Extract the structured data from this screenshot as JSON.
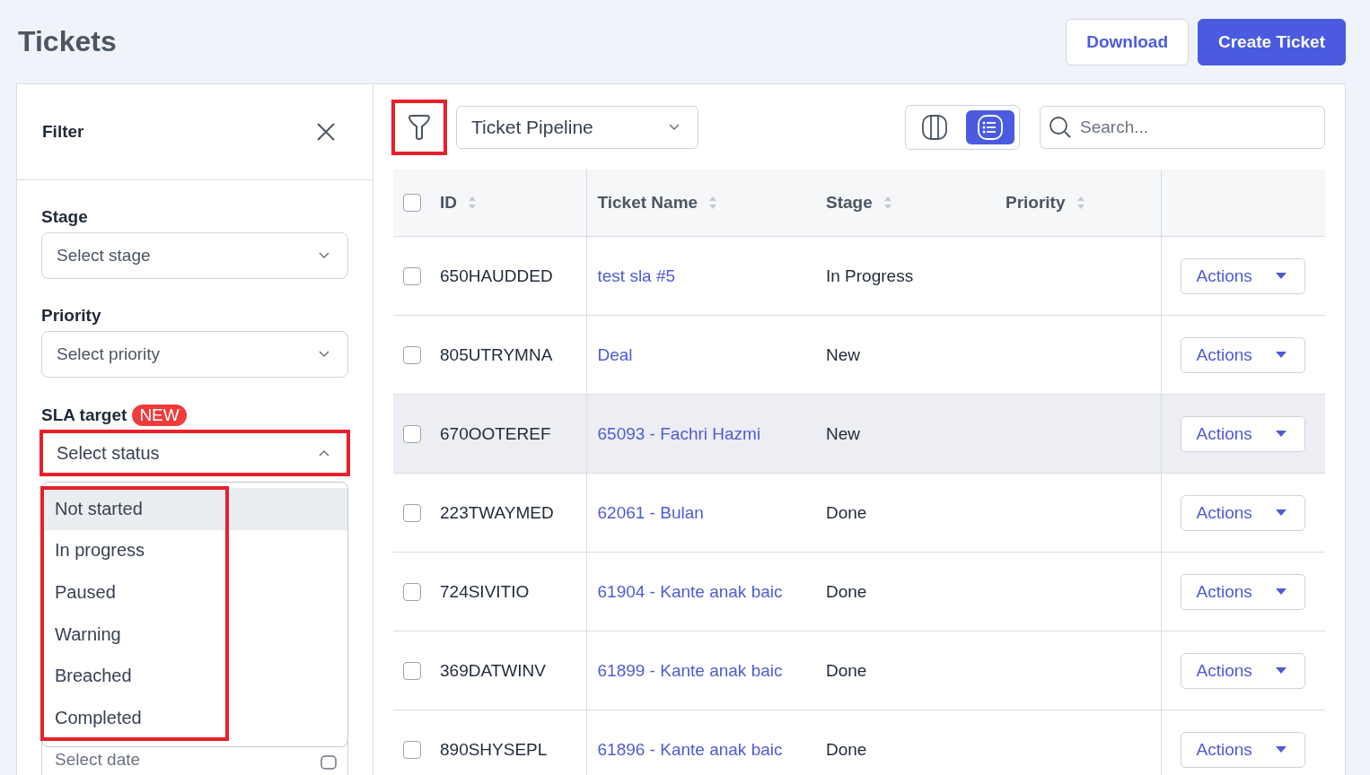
{
  "page": {
    "title": "Tickets",
    "buttons": [
      {
        "label": "Download",
        "kind": "secondary"
      },
      {
        "label": "Create Ticket",
        "kind": "primary"
      }
    ]
  },
  "filter_panel": {
    "title": "Filter",
    "fields": [
      {
        "label": "Stage",
        "placeholder": "Select stage",
        "expanded": false,
        "highlighted": false
      },
      {
        "label": "Priority",
        "placeholder": "Select priority",
        "expanded": false,
        "highlighted": false
      },
      {
        "label": "SLA target",
        "badge": "NEW",
        "placeholder": "Select status",
        "expanded": true,
        "highlighted": true
      }
    ],
    "dropdown": {
      "highlighted": true,
      "options": [
        {
          "label": "Not started",
          "selected": true
        },
        {
          "label": "In progress",
          "selected": false
        },
        {
          "label": "Paused",
          "selected": false
        },
        {
          "label": "Warning",
          "selected": false
        },
        {
          "label": "Breached",
          "selected": false
        },
        {
          "label": "Completed",
          "selected": false
        }
      ]
    },
    "date_field": {
      "placeholder": "Select date"
    }
  },
  "toolbar": {
    "filter_button": {
      "highlighted": true
    },
    "pipeline": "Ticket Pipeline",
    "view_toggle": [
      {
        "kind": "columns",
        "selected": false
      },
      {
        "kind": "list",
        "selected": true
      }
    ],
    "search": {
      "placeholder": "Search..."
    }
  },
  "table": {
    "columns": [
      {
        "label": "ID",
        "sortable": true
      },
      {
        "label": "Ticket Name",
        "sortable": true
      },
      {
        "label": "Stage",
        "sortable": true
      },
      {
        "label": "Priority",
        "sortable": true
      }
    ],
    "all_checked": false,
    "rows": [
      {
        "id": "650HAUDDED",
        "name": "test sla #5",
        "stage": "In Progress",
        "checked": false,
        "hovered": false,
        "action": "Actions"
      },
      {
        "id": "805UTRYMNA",
        "name": "Deal",
        "stage": "New",
        "checked": false,
        "hovered": false,
        "action": "Actions"
      },
      {
        "id": "670OOTEREF",
        "name": "65093 - Fachri Hazmi",
        "stage": "New",
        "checked": false,
        "hovered": true,
        "action": "Actions"
      },
      {
        "id": "223TWAYMED",
        "name": "62061 - Bulan",
        "stage": "Done",
        "checked": false,
        "hovered": false,
        "action": "Actions"
      },
      {
        "id": "724SIVITIO",
        "name": "61904 - Kante anak baic",
        "stage": "Done",
        "checked": false,
        "hovered": false,
        "action": "Actions"
      },
      {
        "id": "369DATWINV",
        "name": "61899 - Kante anak baic",
        "stage": "Done",
        "checked": false,
        "hovered": false,
        "action": "Actions"
      },
      {
        "id": "890SHYSEPL",
        "name": "61896 - Kante anak baic",
        "stage": "Done",
        "checked": false,
        "hovered": false,
        "action": "Actions"
      }
    ]
  }
}
